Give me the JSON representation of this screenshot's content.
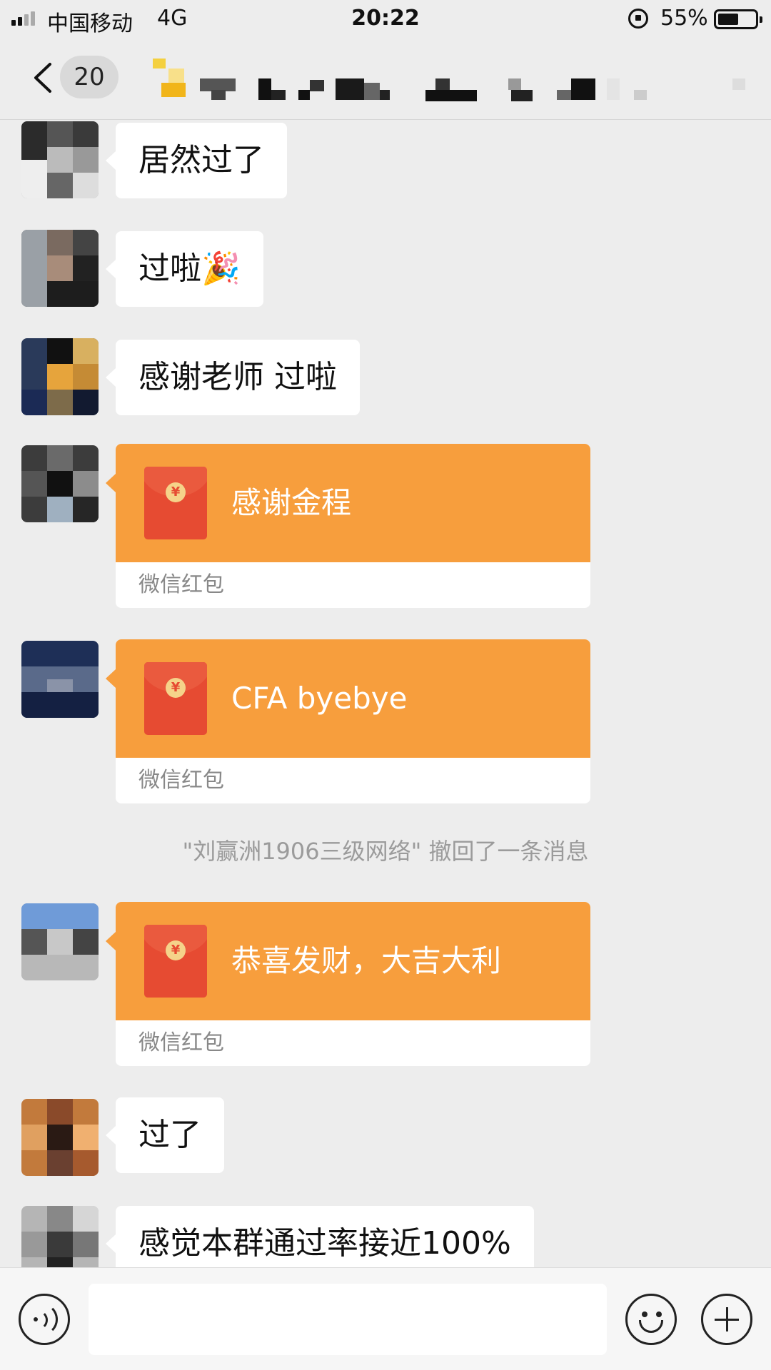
{
  "status_bar": {
    "carrier": "中国移动",
    "network": "4G",
    "time": "20:22",
    "battery_percent": "55%",
    "battery_level": 0.55
  },
  "nav": {
    "unread_count": "20"
  },
  "messages": [
    {
      "type": "text",
      "text": "居然过了"
    },
    {
      "type": "text",
      "text": "过啦🎉"
    },
    {
      "type": "text",
      "text": "感谢老师 过啦"
    },
    {
      "type": "red_packet",
      "title": "感谢金程",
      "footer": "微信红包"
    },
    {
      "type": "red_packet",
      "title": "CFA byebye",
      "footer": "微信红包"
    },
    {
      "type": "system",
      "text": "\"刘赢洲1906三级网络\" 撤回了一条消息"
    },
    {
      "type": "red_packet",
      "title": "恭喜发财，大吉大利",
      "footer": "微信红包"
    },
    {
      "type": "text",
      "text": "过了"
    },
    {
      "type": "text",
      "text": "感觉本群通过率接近100%"
    }
  ],
  "icons": {
    "back": "chevron-left-icon",
    "voice": "voice-icon",
    "emoji": "emoji-icon",
    "more": "plus-icon",
    "currency": "yuan-icon"
  },
  "red_packet_currency_symbol": "¥",
  "colors": {
    "background": "#ededed",
    "red_packet_orange": "#f79e3d",
    "envelope_red": "#e64b32",
    "bubble": "#ffffff"
  }
}
